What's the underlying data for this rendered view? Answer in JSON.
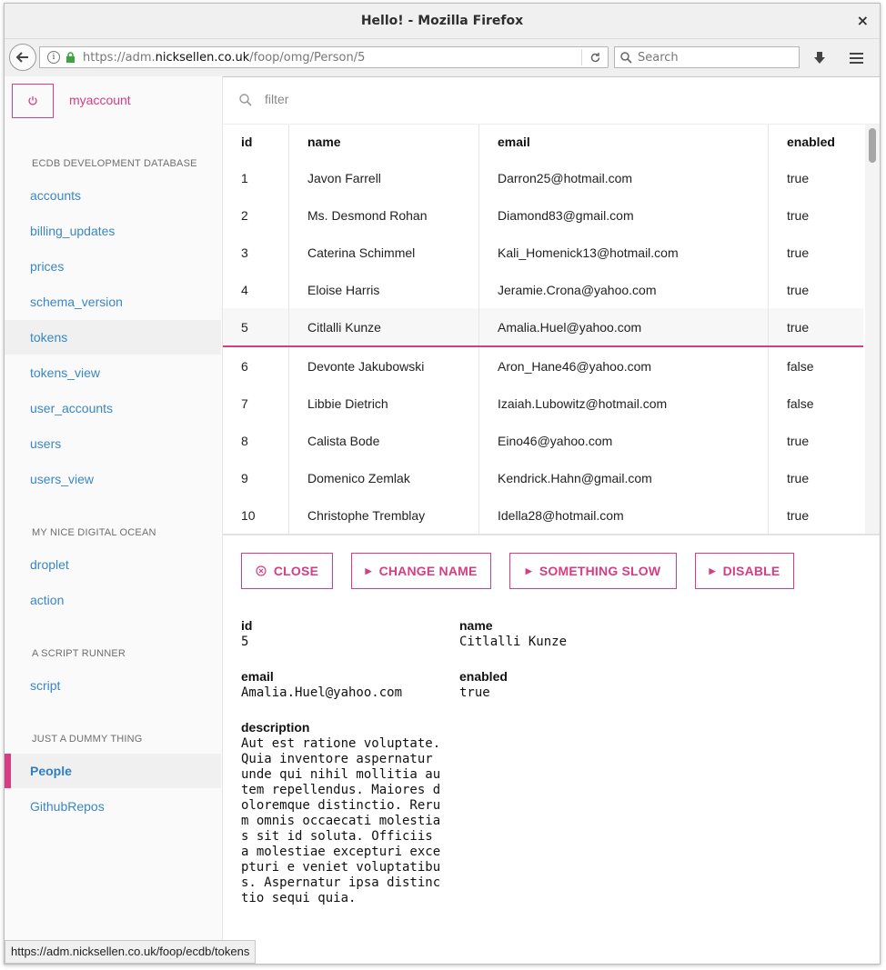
{
  "window": {
    "title": "Hello! - Mozilla Firefox",
    "close_glyph": "×"
  },
  "navbar": {
    "url_prefix": "https://adm.",
    "url_domain": "nicksellen.co.uk",
    "url_path": "/foop/omg/Person/5",
    "search_placeholder": "Search"
  },
  "sidebar": {
    "account_label": "myaccount",
    "sections": [
      {
        "title": "ECDB DEVELOPMENT DATABASE",
        "items": [
          "accounts",
          "billing_updates",
          "prices",
          "schema_version",
          "tokens",
          "tokens_view",
          "user_accounts",
          "users",
          "users_view"
        ]
      },
      {
        "title": "MY NICE DIGITAL OCEAN",
        "items": [
          "droplet",
          "action"
        ]
      },
      {
        "title": "A SCRIPT RUNNER",
        "items": [
          "script"
        ]
      },
      {
        "title": "JUST A DUMMY THING",
        "items": [
          "People",
          "GithubRepos"
        ]
      }
    ],
    "hovered_item": "tokens",
    "active_item": "People"
  },
  "filter": {
    "placeholder": "filter",
    "value": ""
  },
  "table": {
    "columns": [
      "id",
      "name",
      "email",
      "enabled"
    ],
    "rows": [
      [
        "1",
        "Javon Farrell",
        "Darron25@hotmail.com",
        "true"
      ],
      [
        "2",
        "Ms. Desmond Rohan",
        "Diamond83@gmail.com",
        "true"
      ],
      [
        "3",
        "Caterina Schimmel",
        "Kali_Homenick13@hotmail.com",
        "true"
      ],
      [
        "4",
        "Eloise Harris",
        "Jeramie.Crona@yahoo.com",
        "true"
      ],
      [
        "5",
        "Citlalli Kunze",
        "Amalia.Huel@yahoo.com",
        "true"
      ],
      [
        "6",
        "Devonte Jakubowski",
        "Aron_Hane46@yahoo.com",
        "false"
      ],
      [
        "7",
        "Libbie Dietrich",
        "Izaiah.Lubowitz@hotmail.com",
        "false"
      ],
      [
        "8",
        "Calista Bode",
        "Eino46@yahoo.com",
        "true"
      ],
      [
        "9",
        "Domenico Zemlak",
        "Kendrick.Hahn@gmail.com",
        "true"
      ],
      [
        "10",
        "Christophe Tremblay",
        "Idella28@hotmail.com",
        "true"
      ]
    ],
    "selected_row": 4
  },
  "actions": {
    "close": "CLOSE",
    "change_name": "CHANGE NAME",
    "something_slow": "SOMETHING SLOW",
    "disable": "DISABLE"
  },
  "detail": {
    "id_label": "id",
    "id_value": "5",
    "name_label": "name",
    "name_value": "Citlalli Kunze",
    "email_label": "email",
    "email_value": "Amalia.Huel@yahoo.com",
    "enabled_label": "enabled",
    "enabled_value": "true",
    "description_label": "description",
    "description_value": "Aut est ratione voluptate. Quia inventore aspernatur unde qui nihil mollitia autem repellendus. Maiores doloremque distinctio. Rerum omnis occaecati molestias sit id soluta. Officiis a molestiae excepturi excepturi e veniet voluptatibus. Aspernatur ipsa distinctio sequi quia."
  },
  "statusbar": {
    "text": "https://adm.nicksellen.co.uk/foop/ecdb/tokens"
  },
  "colors": {
    "accent": "#d63d82",
    "link": "#3a87c2"
  }
}
